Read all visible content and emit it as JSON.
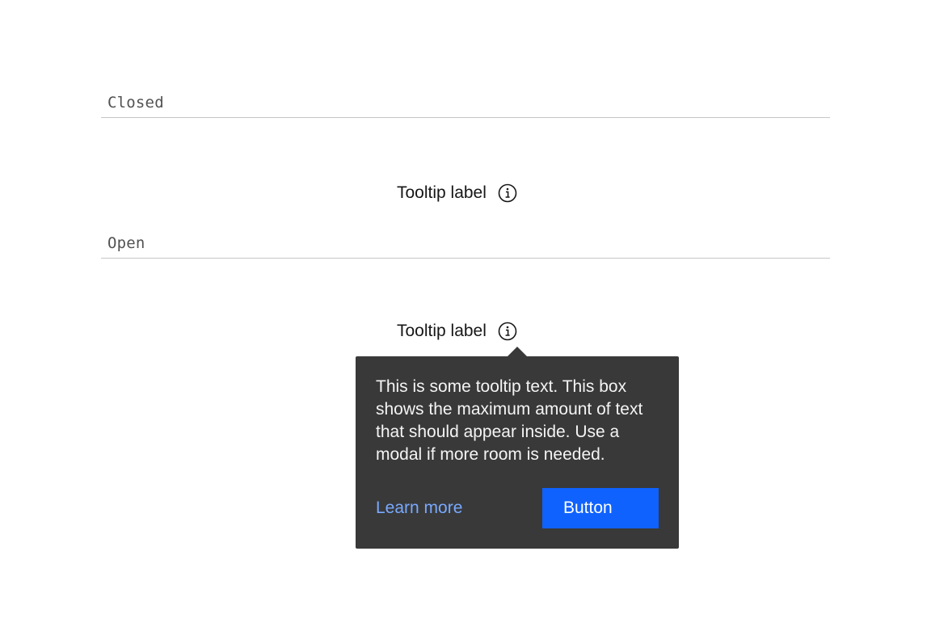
{
  "states": {
    "closed": {
      "section_label": "Closed",
      "trigger_label": "Tooltip label",
      "trigger_icon": "info-icon"
    },
    "open": {
      "section_label": "Open",
      "trigger_label": "Tooltip label",
      "trigger_icon": "info-icon",
      "tooltip": {
        "body": "This is some tooltip text. This box shows the maximum amount of text that should appear inside. Use a modal if more room is needed.",
        "link_label": "Learn more",
        "button_label": "Button"
      }
    }
  },
  "colors": {
    "tooltip_background": "#393939",
    "tooltip_text": "#f4f4f4",
    "link": "#78a9ff",
    "primary_button": "#0f62fe",
    "divider": "#c6c6c6",
    "section_label": "#525252"
  }
}
